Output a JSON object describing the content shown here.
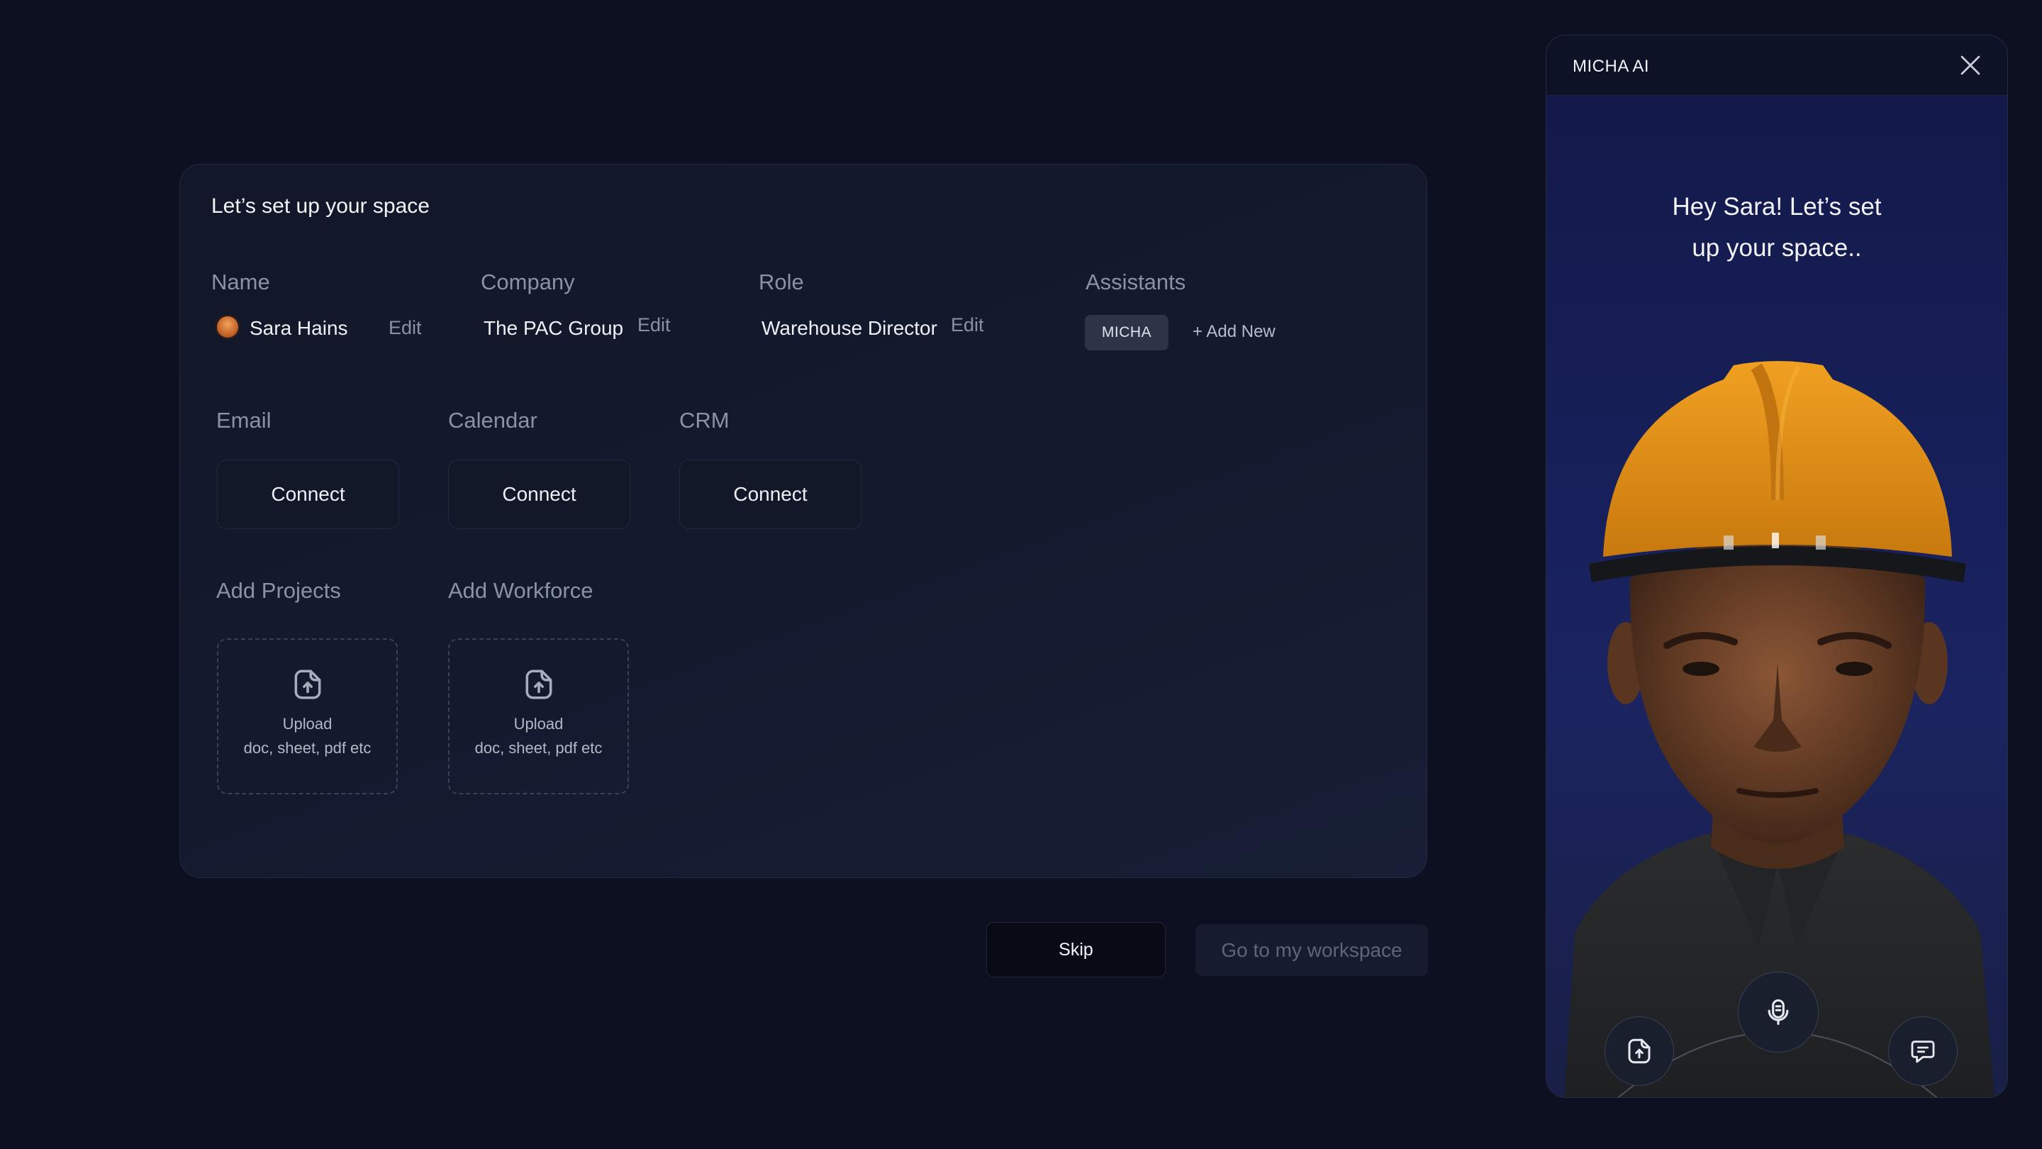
{
  "setup": {
    "title": "Let’s set up your space",
    "name_label": "Name",
    "name_value": "Sara Hains",
    "name_edit": "Edit",
    "company_label": "Company",
    "company_value": "The PAC Group",
    "company_edit": "Edit",
    "role_label": "Role",
    "role_value": "Warehouse Director",
    "role_edit": "Edit",
    "assistants_label": "Assistants",
    "assistant_chip": "MICHA",
    "add_new": "+ Add New",
    "email_label": "Email",
    "calendar_label": "Calendar",
    "crm_label": "CRM",
    "connect_label": "Connect",
    "projects_label": "Add Projects",
    "workforce_label": "Add Workforce",
    "upload_title": "Upload",
    "upload_sub": "doc, sheet, pdf etc"
  },
  "actions": {
    "skip": "Skip",
    "go_workspace": "Go to my workspace"
  },
  "assistant_panel": {
    "title": "MICHA AI",
    "greeting": "Hey Sara! Let’s set\nup your space.."
  },
  "icons": {
    "avatar": "user-avatar",
    "upload": "file-upload-icon",
    "close": "close-icon",
    "mic": "microphone-icon",
    "chat": "chat-icon"
  },
  "colors": {
    "background": "#0c1020",
    "card": "#141a2e",
    "muted_text": "#8b92a6",
    "chip": "#2d3447",
    "panel_bg": "#17205a",
    "helmet": "#e8901a"
  }
}
